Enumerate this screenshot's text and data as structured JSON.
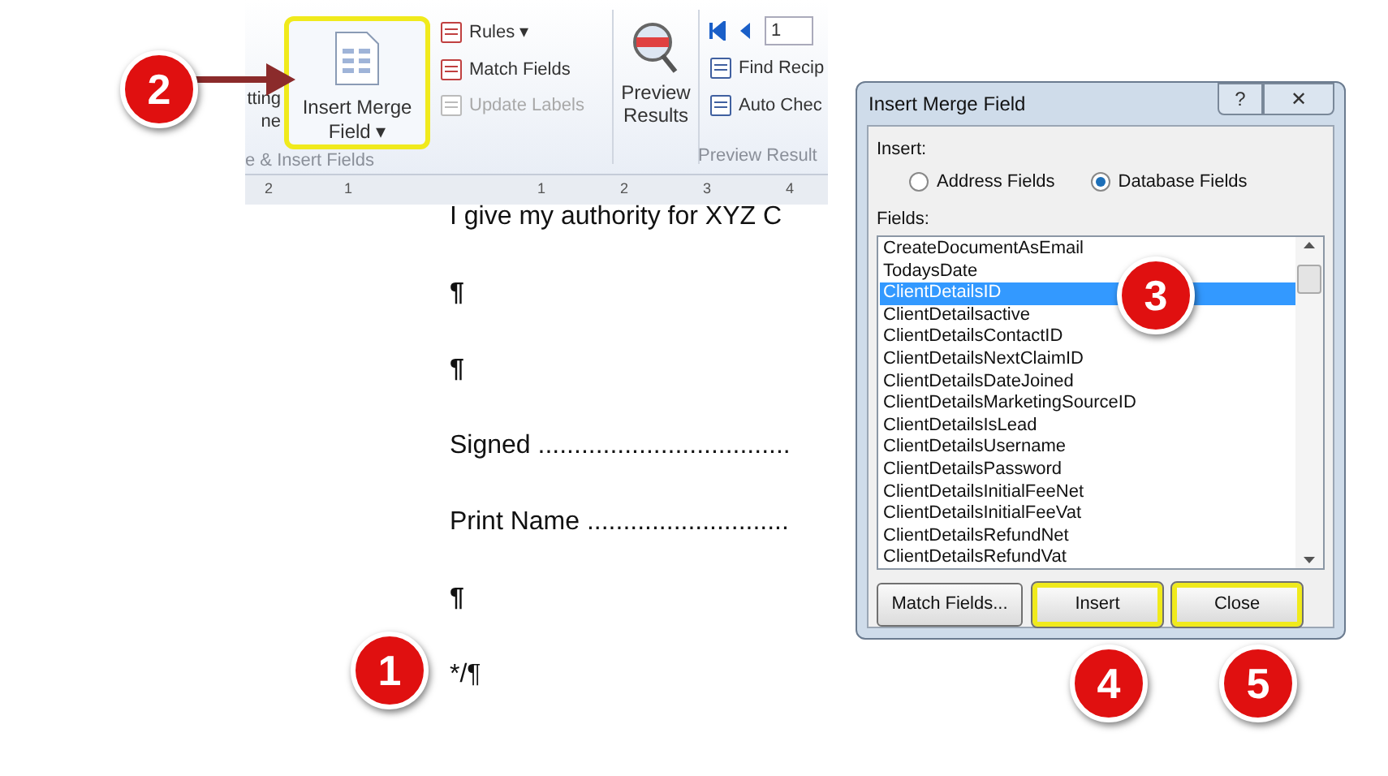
{
  "ribbon": {
    "left_cut_labels": [
      "tting",
      "ne"
    ],
    "insert_merge_field": {
      "label": "Insert Merge",
      "label2": "Field ▾",
      "highlighted": true
    },
    "small_buttons": [
      {
        "label": "Rules ▾",
        "disabled": false
      },
      {
        "label": "Match Fields",
        "disabled": false
      },
      {
        "label": "Update Labels",
        "disabled": true
      }
    ],
    "preview_button": {
      "label": "Preview",
      "label2": "Results"
    },
    "nav": {
      "record": "1"
    },
    "right_buttons": [
      {
        "label": "Find Recip"
      },
      {
        "label": "Auto Chec"
      }
    ],
    "group_labels": [
      "e & Insert Fields",
      "Preview Result"
    ],
    "ruler_numbers": [
      "2",
      "1",
      "1",
      "2",
      "3",
      "4"
    ]
  },
  "document": {
    "lines": [
      {
        "kind": "text",
        "text": "I give my authority for XYZ C"
      },
      {
        "kind": "mark",
        "text": "¶"
      },
      {
        "kind": "mark",
        "text": "¶"
      },
      {
        "kind": "text",
        "text": "Signed ..................................."
      },
      {
        "kind": "text",
        "text": "Print Name ............................"
      },
      {
        "kind": "mark",
        "text": "¶"
      },
      {
        "kind": "text",
        "text": "*/¶"
      }
    ]
  },
  "dialog": {
    "title": "Insert Merge Field",
    "help": "?",
    "close": "✕",
    "insert_label": "Insert:",
    "radios": [
      {
        "label": "Address Fields",
        "selected": false
      },
      {
        "label": "Database Fields",
        "selected": true
      }
    ],
    "fields_label": "Fields:",
    "fields": [
      {
        "name": "CreateDocumentAsEmail",
        "selected": false
      },
      {
        "name": "TodaysDate",
        "selected": false
      },
      {
        "name": "ClientDetailsID",
        "selected": true
      },
      {
        "name": "ClientDetailsactive",
        "selected": false
      },
      {
        "name": "ClientDetailsContactID",
        "selected": false
      },
      {
        "name": "ClientDetailsNextClaimID",
        "selected": false
      },
      {
        "name": "ClientDetailsDateJoined",
        "selected": false
      },
      {
        "name": "ClientDetailsMarketingSourceID",
        "selected": false
      },
      {
        "name": "ClientDetailsIsLead",
        "selected": false
      },
      {
        "name": "ClientDetailsUsername",
        "selected": false
      },
      {
        "name": "ClientDetailsPassword",
        "selected": false
      },
      {
        "name": "ClientDetailsInitialFeeNet",
        "selected": false
      },
      {
        "name": "ClientDetailsInitialFeeVat",
        "selected": false
      },
      {
        "name": "ClientDetailsRefundNet",
        "selected": false
      },
      {
        "name": "ClientDetailsRefundVat",
        "selected": false
      }
    ],
    "buttons": [
      {
        "label": "Match Fields...",
        "highlighted": false
      },
      {
        "label": "Insert",
        "highlighted": true
      },
      {
        "label": "Close",
        "highlighted": true
      }
    ]
  },
  "callouts": [
    {
      "number": "1"
    },
    {
      "number": "2"
    },
    {
      "number": "3"
    },
    {
      "number": "4"
    },
    {
      "number": "5"
    }
  ]
}
